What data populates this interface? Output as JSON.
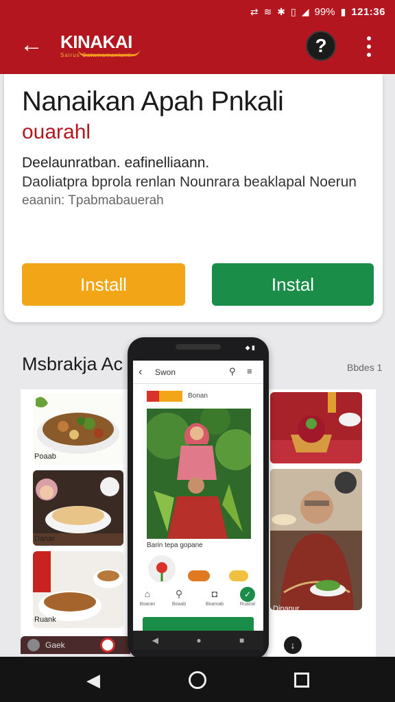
{
  "status_bar": {
    "battery": "99%",
    "time": "121:36"
  },
  "app_bar": {
    "logo_title": "KINAKAI",
    "logo_sub": "Sairus     Catamamanlanti",
    "help_label": "?"
  },
  "app": {
    "title": "Nanaikan Apah Pnkali",
    "developer": "ouarahl",
    "desc_line1": "Deelaunratban. eafinelliaann.",
    "desc_line2": "Daoliatpra bprola renlan Nounrara beaklapal Noerun",
    "desc_line3": "eaanin: Tpabmabauerah",
    "install_orange_label": "Install",
    "install_green_label": "Instal"
  },
  "screenshots_section": {
    "title": "Msbrakja Ac",
    "link": "Bbdes 1",
    "left_labels": [
      "Poaab",
      "Danar",
      "Ruank"
    ],
    "right_label": "Dinanur",
    "bottom_left_text": "Gaek"
  },
  "phone": {
    "screen_title": "Swon",
    "tag_text": "Bonan",
    "caption": "Barin tepa gopane",
    "icons": [
      {
        "name": "home",
        "label": "Boaran"
      },
      {
        "name": "search",
        "label": "Boaab"
      },
      {
        "name": "bag",
        "label": "Boamab"
      },
      {
        "name": "check",
        "label": "Ruanal"
      }
    ]
  },
  "colors": {
    "brand_red": "#b3161f",
    "install_orange": "#f2a516",
    "install_green": "#1a8d48"
  }
}
